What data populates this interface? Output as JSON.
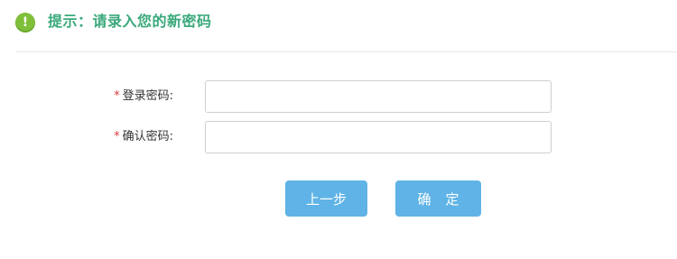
{
  "notice": {
    "icon": "exclamation-circle-icon",
    "icon_glyph": "!",
    "text": "提示：请录入您的新密码"
  },
  "form": {
    "required_marker": "*",
    "login_password": {
      "label": "登录密码:",
      "value": ""
    },
    "confirm_password": {
      "label": "确认密码:",
      "value": ""
    }
  },
  "buttons": {
    "prev_label": "上一步",
    "confirm_label": "确定"
  },
  "colors": {
    "notice_icon": "#7fbf3a",
    "notice_text": "#3aa97b",
    "required_marker": "#e03a3a",
    "button": "#5fb3e6"
  }
}
